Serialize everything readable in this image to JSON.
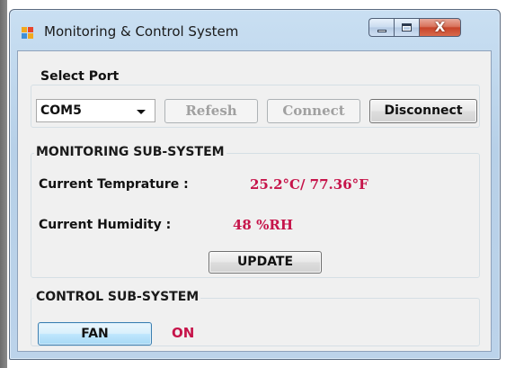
{
  "window": {
    "title": "Monitoring & Control System",
    "close_glyph": "X"
  },
  "port": {
    "group_label": "Select Port",
    "selected_port": "COM5",
    "refresh_label": "Refesh",
    "connect_label": "Connect",
    "disconnect_label": "Disconnect"
  },
  "monitoring": {
    "group_label": "MONITORING SUB-SYSTEM",
    "temperature_label": "Current Temprature :",
    "temperature_value": "25.2°C/ 77.36°F",
    "humidity_label": "Current Humidity :",
    "humidity_value": "48 %RH",
    "update_label": "UPDATE"
  },
  "control": {
    "group_label": "CONTROL SUB-SYSTEM",
    "fan_label": "FAN",
    "fan_status": "ON"
  },
  "icons": {
    "app": "app-window-icon",
    "combo_arrow": "chevron-down-icon"
  },
  "colors": {
    "value_text": "#c6144a",
    "focus_border": "#3c7fb1",
    "disabled_text": "#a0a0a0"
  }
}
